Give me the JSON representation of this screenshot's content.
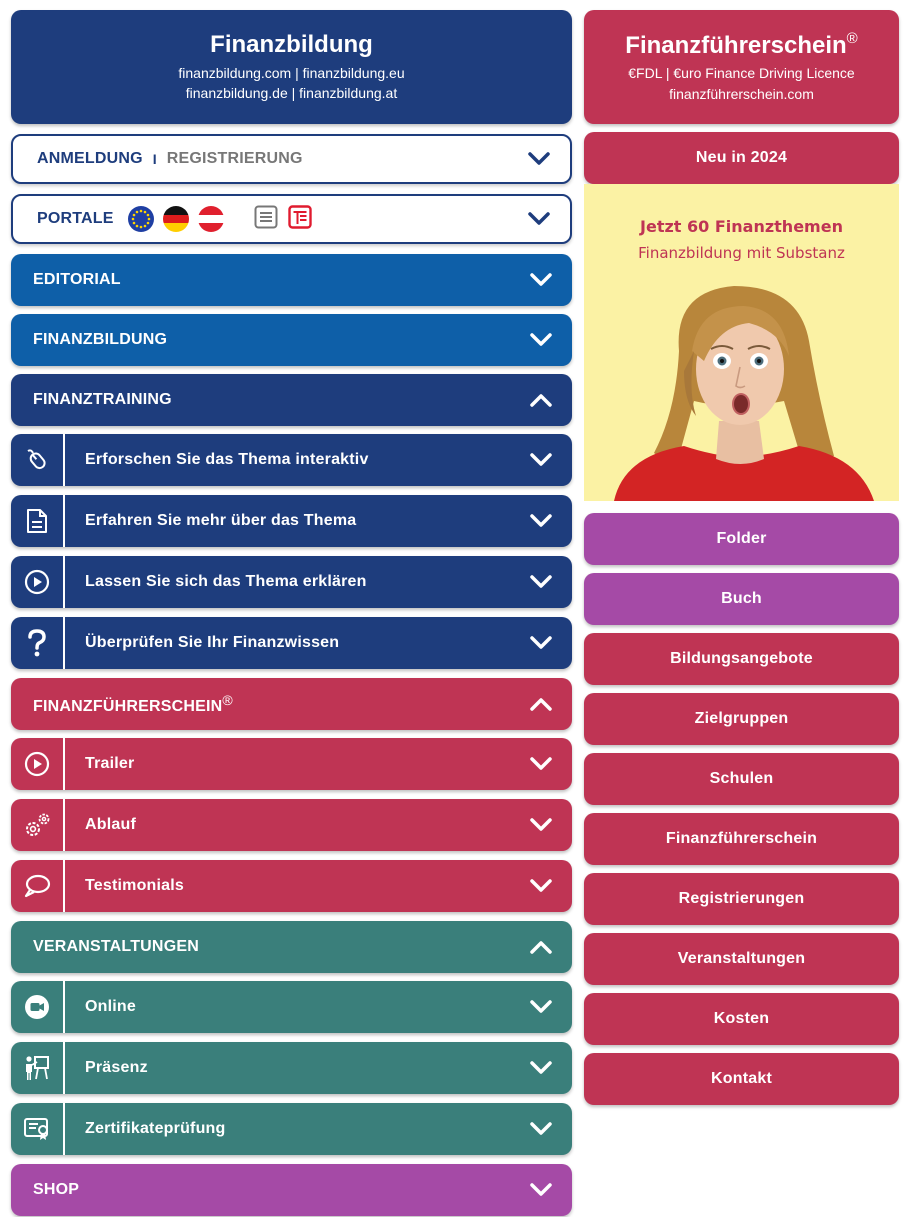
{
  "left_header": {
    "title": "Finanzbildung",
    "line1": "finanzbildung.com | finanzbildung.eu",
    "line2": "finanzbildung.de | finanzbildung.at"
  },
  "right_header": {
    "title": "Finanzführerschein",
    "reg": "®",
    "line1": "€FDL | €uro Finance Driving Licence",
    "line2": "finanzführerschein.com"
  },
  "login": {
    "anmeldung": "ANMELDUNG",
    "sep": "I",
    "registrierung": "REGISTRIERUNG"
  },
  "portale": {
    "label": "PORTALE"
  },
  "sections": {
    "editorial": "EDITORIAL",
    "finanzbildung": "FINANZBILDUNG",
    "finanztraining": "FINANZTRAINING",
    "finanzfuehrerschein": "FINANZFÜHRERSCHEIN",
    "finanzfuehrerschein_reg": "®",
    "veranstaltungen": "VERANSTALTUNGEN",
    "shop": "SHOP"
  },
  "finanztraining_items": [
    {
      "label": "Erforschen Sie das Thema interaktiv",
      "icon": "mouse-icon"
    },
    {
      "label": "Erfahren Sie mehr über das Thema",
      "icon": "document-icon"
    },
    {
      "label": "Lassen Sie sich das Thema erklären",
      "icon": "play-icon"
    },
    {
      "label": "Überprüfen Sie Ihr Finanzwissen",
      "icon": "question-icon"
    }
  ],
  "fuehrerschein_items": [
    {
      "label": "Trailer",
      "icon": "play-icon"
    },
    {
      "label": "Ablauf",
      "icon": "gears-icon"
    },
    {
      "label": "Testimonials",
      "icon": "speech-bubble-icon"
    }
  ],
  "veranstaltungen_items": [
    {
      "label": "Online",
      "icon": "video-camera-icon"
    },
    {
      "label": "Präsenz",
      "icon": "presenter-icon"
    },
    {
      "label": "Zertifikateprüfung",
      "icon": "certificate-icon"
    }
  ],
  "right": {
    "neu": "Neu in 2024",
    "promo_title": "Jetzt 60 Finanzthemen",
    "promo_sub": "Finanzbildung mit Substanz",
    "buttons": [
      "Folder",
      "Buch",
      "Bildungsangebote",
      "Zielgruppen",
      "Schulen",
      "Finanzführerschein",
      "Registrierungen",
      "Veranstaltungen",
      "Kosten",
      "Kontakt"
    ]
  },
  "colors": {
    "navy": "#1e3d7d",
    "blue": "#0e5fa8",
    "red": "#bf3454",
    "teal": "#3a7f7b",
    "purple": "#a54aa6",
    "promo_bg": "#fbf2a4"
  }
}
